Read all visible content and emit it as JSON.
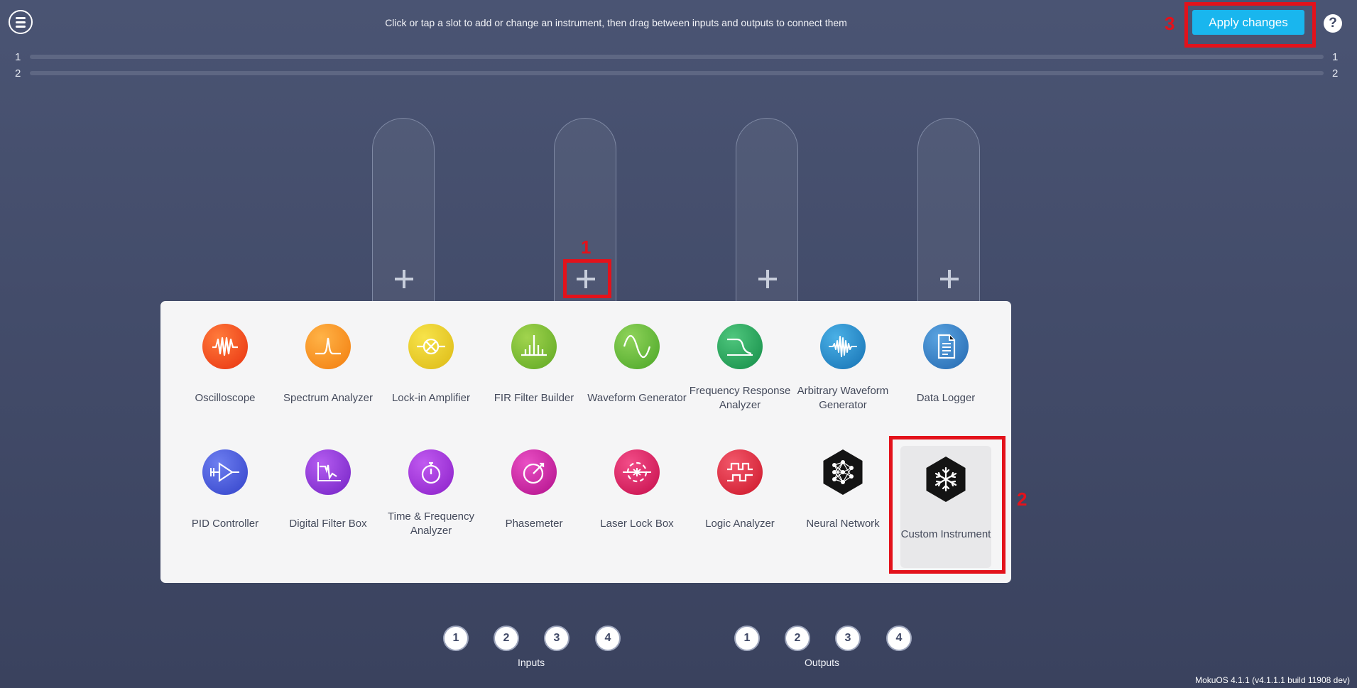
{
  "header": {
    "instructions": "Click or tap a slot to add or change an instrument, then drag between inputs and outputs to connect them",
    "apply_label": "Apply changes",
    "help_label": "?"
  },
  "channels": {
    "left": [
      "1",
      "2"
    ],
    "right": [
      "1",
      "2"
    ]
  },
  "annotations": [
    "1",
    "2",
    "3"
  ],
  "instruments": [
    {
      "label": "Oscilloscope",
      "icon": "oscilloscope-icon",
      "color": "#f2431a"
    },
    {
      "label": "Spectrum Analyzer",
      "icon": "spectrum-analyzer-icon",
      "color": "#f98f12"
    },
    {
      "label": "Lock-in Amplifier",
      "icon": "lock-in-amplifier-icon",
      "color": "#e7c91c"
    },
    {
      "label": "FIR Filter Builder",
      "icon": "fir-filter-icon",
      "color": "#74b72c"
    },
    {
      "label": "Waveform Generator",
      "icon": "waveform-generator-icon",
      "color": "#5cb130"
    },
    {
      "label": "Frequency Response Analyzer",
      "icon": "frequency-response-icon",
      "color": "#21a057"
    },
    {
      "label": "Arbitrary Waveform Generator",
      "icon": "arbitrary-waveform-icon",
      "color": "#1d88c5"
    },
    {
      "label": "Data Logger",
      "icon": "data-logger-icon",
      "color": "#2f7fc4"
    },
    {
      "label": "PID Controller",
      "icon": "pid-controller-icon",
      "color": "#4459dd"
    },
    {
      "label": "Digital Filter Box",
      "icon": "digital-filter-icon",
      "color": "#8a2fd7"
    },
    {
      "label": "Time & Frequency Analyzer",
      "icon": "time-frequency-icon",
      "color": "#a12fd2"
    },
    {
      "label": "Phasemeter",
      "icon": "phasemeter-icon",
      "color": "#cf1ea3"
    },
    {
      "label": "Laser Lock Box",
      "icon": "laser-lock-icon",
      "color": "#e21a5f"
    },
    {
      "label": "Logic Analyzer",
      "icon": "logic-analyzer-icon",
      "color": "#e8263d"
    },
    {
      "label": "Neural Network",
      "icon": "neural-network-icon",
      "color": "#141414"
    },
    {
      "label": "Custom Instrument",
      "icon": "snowflake-icon",
      "color": "#141414"
    }
  ],
  "inputs": {
    "label": "Inputs",
    "ports": [
      "1",
      "2",
      "3",
      "4"
    ]
  },
  "outputs": {
    "label": "Outputs",
    "ports": [
      "1",
      "2",
      "3",
      "4"
    ]
  },
  "version": "MokuOS 4.1.1 (v4.1.1.1 build 11908 dev)"
}
